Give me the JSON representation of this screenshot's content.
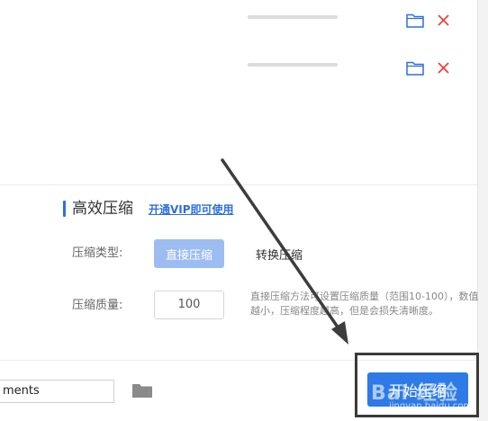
{
  "file_list": {
    "rows": [
      {
        "progress": 0
      },
      {
        "progress": 0
      }
    ]
  },
  "settings": {
    "section_title": "高效压缩",
    "vip_link": "开通VIP即可使用",
    "compress_type_label": "压缩类型:",
    "compress_type_options": [
      "直接压缩",
      "转换压缩"
    ],
    "compress_type_selected": "直接压缩",
    "quality_label": "压缩质量:",
    "quality_value": "100",
    "hint": "直接压缩方法可设置压缩质量（范围10-100），数值越小，压缩程度越高，但是会损失清晰度。"
  },
  "bottom": {
    "path_value": "ments",
    "start_button": "开始压缩"
  },
  "watermark": {
    "logo": "Bai 经验",
    "url": "jingyan.baidu.com"
  },
  "colors": {
    "accent": "#2e6fdf",
    "delete": "#e8453c",
    "primary_button": "#2e7ae6"
  }
}
